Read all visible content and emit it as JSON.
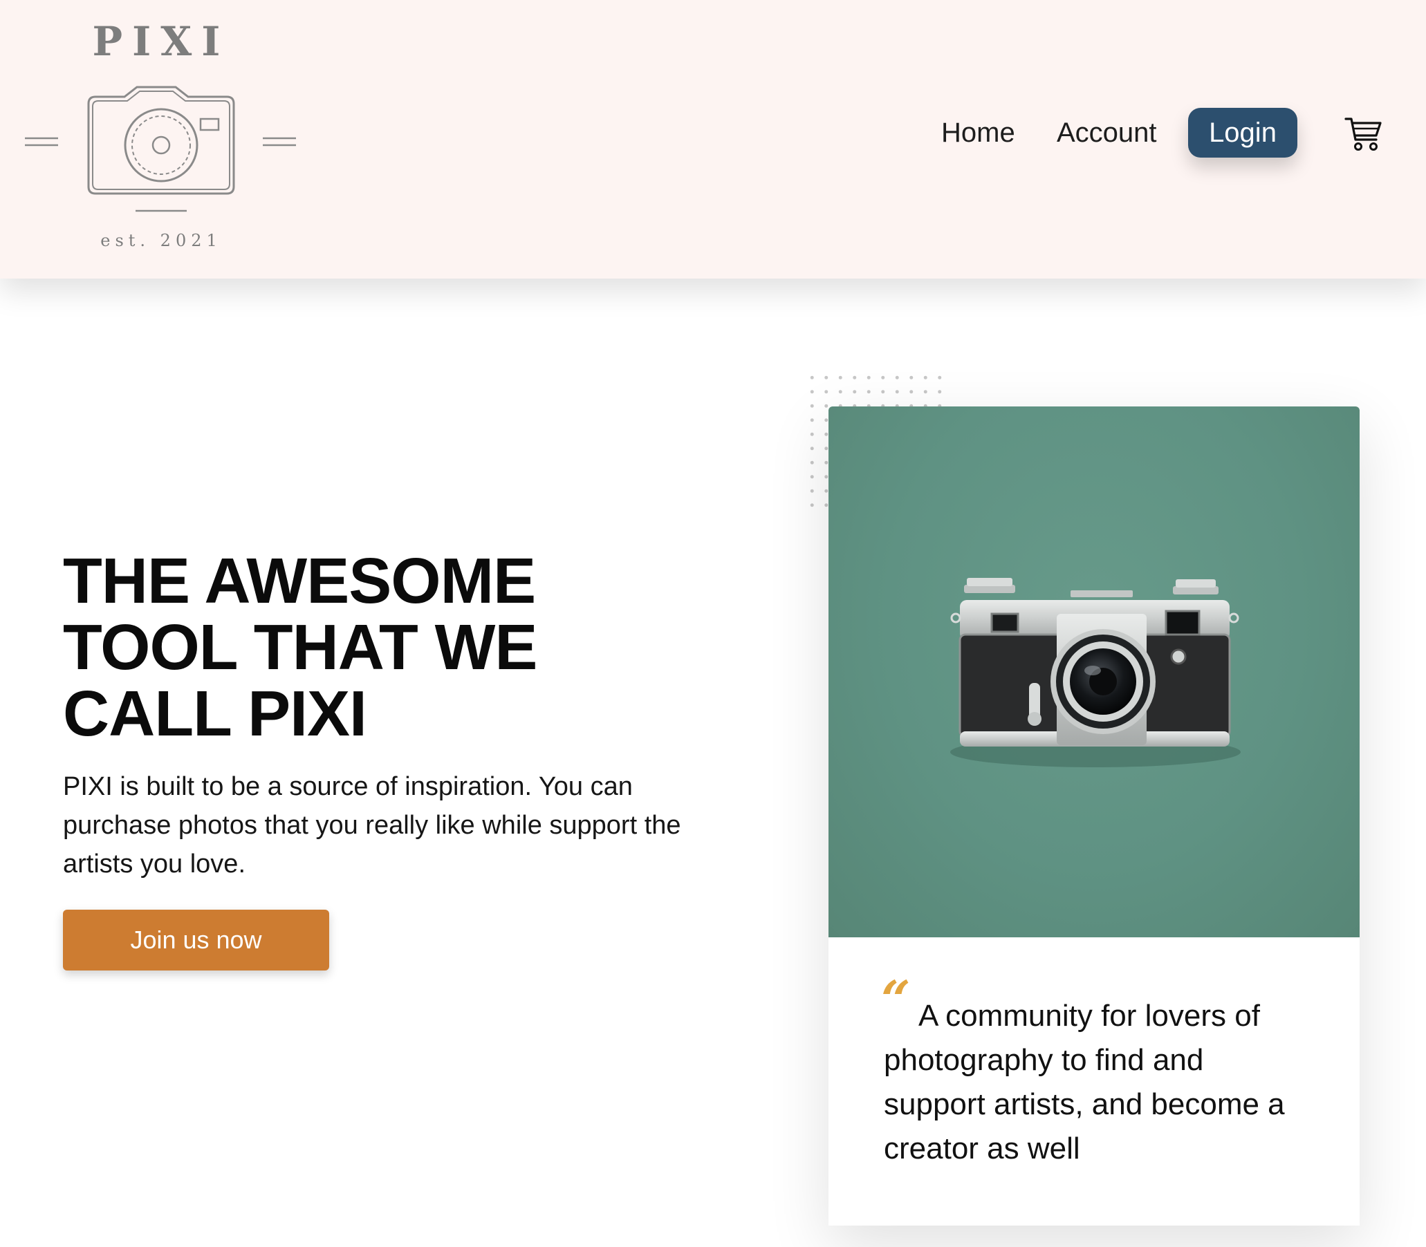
{
  "brand": {
    "name": "PIXI",
    "tagline": "est. 2021"
  },
  "nav": {
    "home_label": "Home",
    "account_label": "Account",
    "login_label": "Login",
    "cart_icon": "cart-icon"
  },
  "hero": {
    "title": "THE AWESOME TOOL THAT WE CALL PIXI",
    "description": "PIXI is built to be a source of inspiration. You can purchase photos that you really like while support the artists you love.",
    "cta_label": "Join us now"
  },
  "feature_card": {
    "quote_mark": "“",
    "quote": "A community for lovers of photography to find and support artists, and become a creator as well"
  },
  "colors": {
    "header_bg": "#fdf4f2",
    "login_bg": "#2c4f6e",
    "cta_bg": "#cd7c31",
    "photo_bg": "#5f9283",
    "quote_accent": "#e3a53f"
  }
}
